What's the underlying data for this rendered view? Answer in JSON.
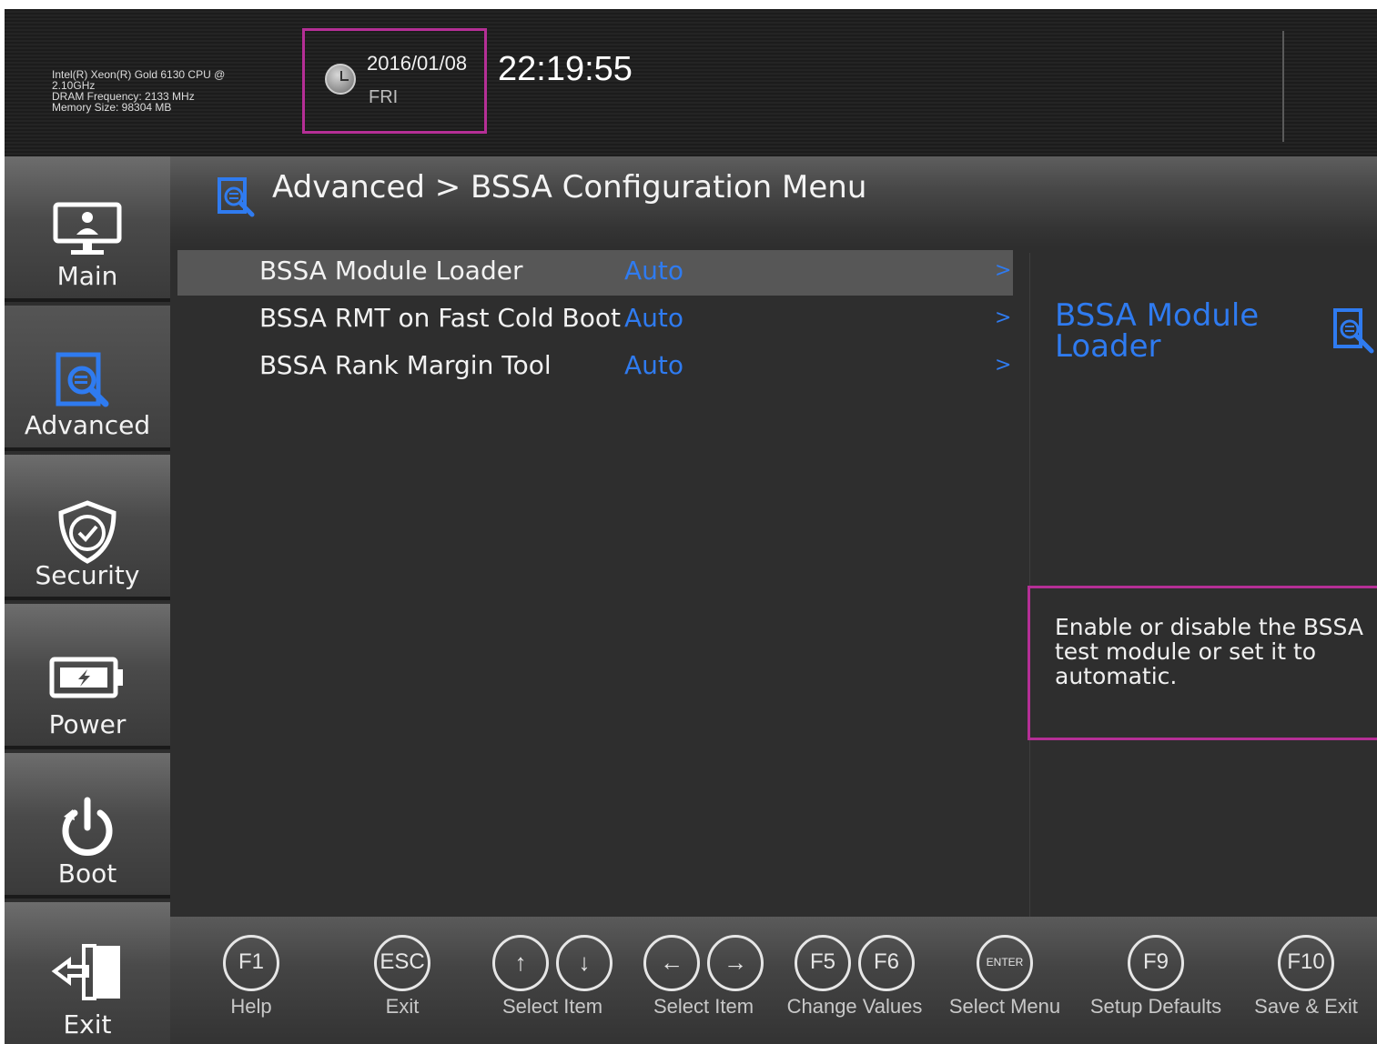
{
  "header": {
    "cpu_line1": "Intel(R) Xeon(R) Gold 6130 CPU @",
    "cpu_line2": "2.10GHz",
    "dram": "DRAM Frequency: 2133 MHz",
    "memory": "Memory Size: 98304 MB",
    "date": "2016/01/08",
    "day": "FRI",
    "time": "22:19:55"
  },
  "nav": [
    {
      "label": "Main",
      "icon": "monitor-icon"
    },
    {
      "label": "Advanced",
      "icon": "advanced-icon",
      "active": true
    },
    {
      "label": "Security",
      "icon": "shield-icon"
    },
    {
      "label": "Power",
      "icon": "battery-icon"
    },
    {
      "label": "Boot",
      "icon": "power-icon"
    },
    {
      "label": "Exit",
      "icon": "exit-icon"
    }
  ],
  "breadcrumb": "Advanced > BSSA Configuration Menu",
  "settings": [
    {
      "name": "BSSA Module Loader",
      "value": "Auto",
      "arrow": ">"
    },
    {
      "name": "BSSA RMT on Fast Cold Boot",
      "value": "Auto",
      "arrow": ">"
    },
    {
      "name": "BSSA Rank Margin Tool",
      "value": "Auto",
      "arrow": ">"
    }
  ],
  "help": {
    "title": "BSSA Module Loader",
    "text": "Enable or disable the BSSA test module or set it to automatic."
  },
  "footer": {
    "keys": {
      "f1": "F1",
      "esc": "ESC",
      "up": "↑",
      "down": "↓",
      "left": "←",
      "right": "→",
      "f5": "F5",
      "f6": "F6",
      "enter": "ENTER",
      "f9": "F9",
      "f10": "F10"
    },
    "labels": {
      "help": "Help",
      "exit": "Exit",
      "select_item_v": "Select Item",
      "select_item_h": "Select Item",
      "change_values": "Change Values",
      "select_menu": "Select Menu",
      "setup_defaults": "Setup Defaults",
      "save_exit": "Save & Exit"
    }
  },
  "colors": {
    "accent_blue": "#2f7bf0",
    "highlight_magenta": "#b52f96"
  }
}
